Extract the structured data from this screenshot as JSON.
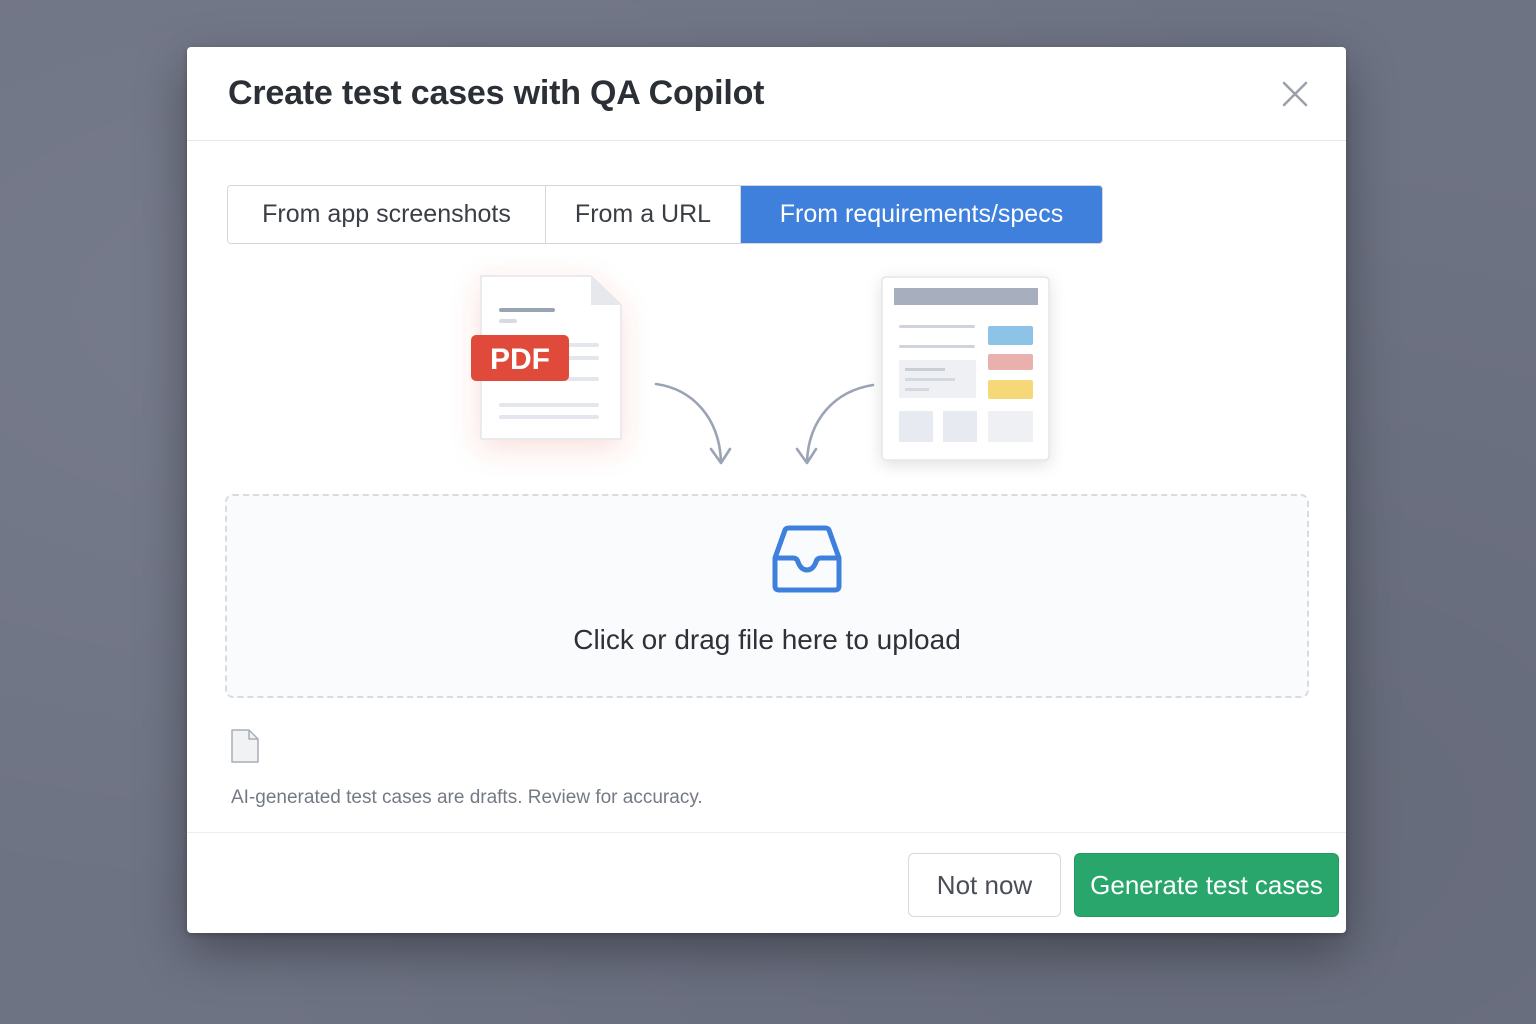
{
  "modal": {
    "title": "Create test cases with QA Copilot",
    "close_icon": "close-icon"
  },
  "tabs": [
    {
      "label": "From app screenshots",
      "active": false
    },
    {
      "label": "From a URL",
      "active": false
    },
    {
      "label": "From requirements/specs",
      "active": true
    }
  ],
  "illustration": {
    "pdf_badge": "PDF",
    "icons": [
      "pdf-document-icon",
      "spec-page-icon",
      "curved-arrow-icon"
    ]
  },
  "dropzone": {
    "icon": "inbox-icon",
    "text": "Click or drag file here to upload"
  },
  "file_icon": "file-icon",
  "disclaimer": "AI-generated test cases are drafts. Review for accuracy.",
  "footer": {
    "secondary_label": "Not now",
    "primary_label": "Generate test cases"
  },
  "colors": {
    "accent_blue": "#3f80dc",
    "primary_green": "#28a66b",
    "pdf_red": "#e04a3a"
  }
}
